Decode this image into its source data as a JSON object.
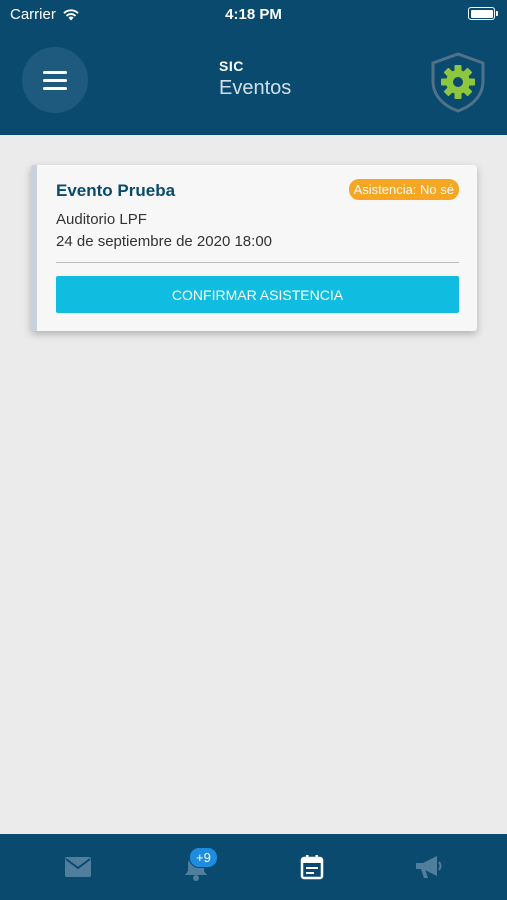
{
  "status_bar": {
    "carrier": "Carrier",
    "time": "4:18 PM"
  },
  "header": {
    "app_title": "SIC",
    "page_title": "Eventos",
    "menu_icon": "hamburger-menu-icon",
    "settings_icon": "shield-gear-icon"
  },
  "events": [
    {
      "title": "Evento Prueba",
      "attendance_badge": "Asistencia: No sé",
      "location": "Auditorio LPF",
      "date": "24 de septiembre de 2020 18:00",
      "confirm_label": "CONFIRMAR ASISTENCIA"
    }
  ],
  "tab_bar": {
    "tabs": [
      {
        "id": "mail",
        "icon": "mail-icon"
      },
      {
        "id": "notifications",
        "icon": "bell-icon",
        "badge": "+9"
      },
      {
        "id": "events",
        "icon": "calendar-icon",
        "active": true
      },
      {
        "id": "announcements",
        "icon": "megaphone-icon"
      }
    ]
  },
  "colors": {
    "primary": "#0b4a6f",
    "accent": "#10bde0",
    "badge_warning": "#f6a623",
    "settings_green": "#8dc63f",
    "tab_inactive": "#4f7f9c"
  }
}
